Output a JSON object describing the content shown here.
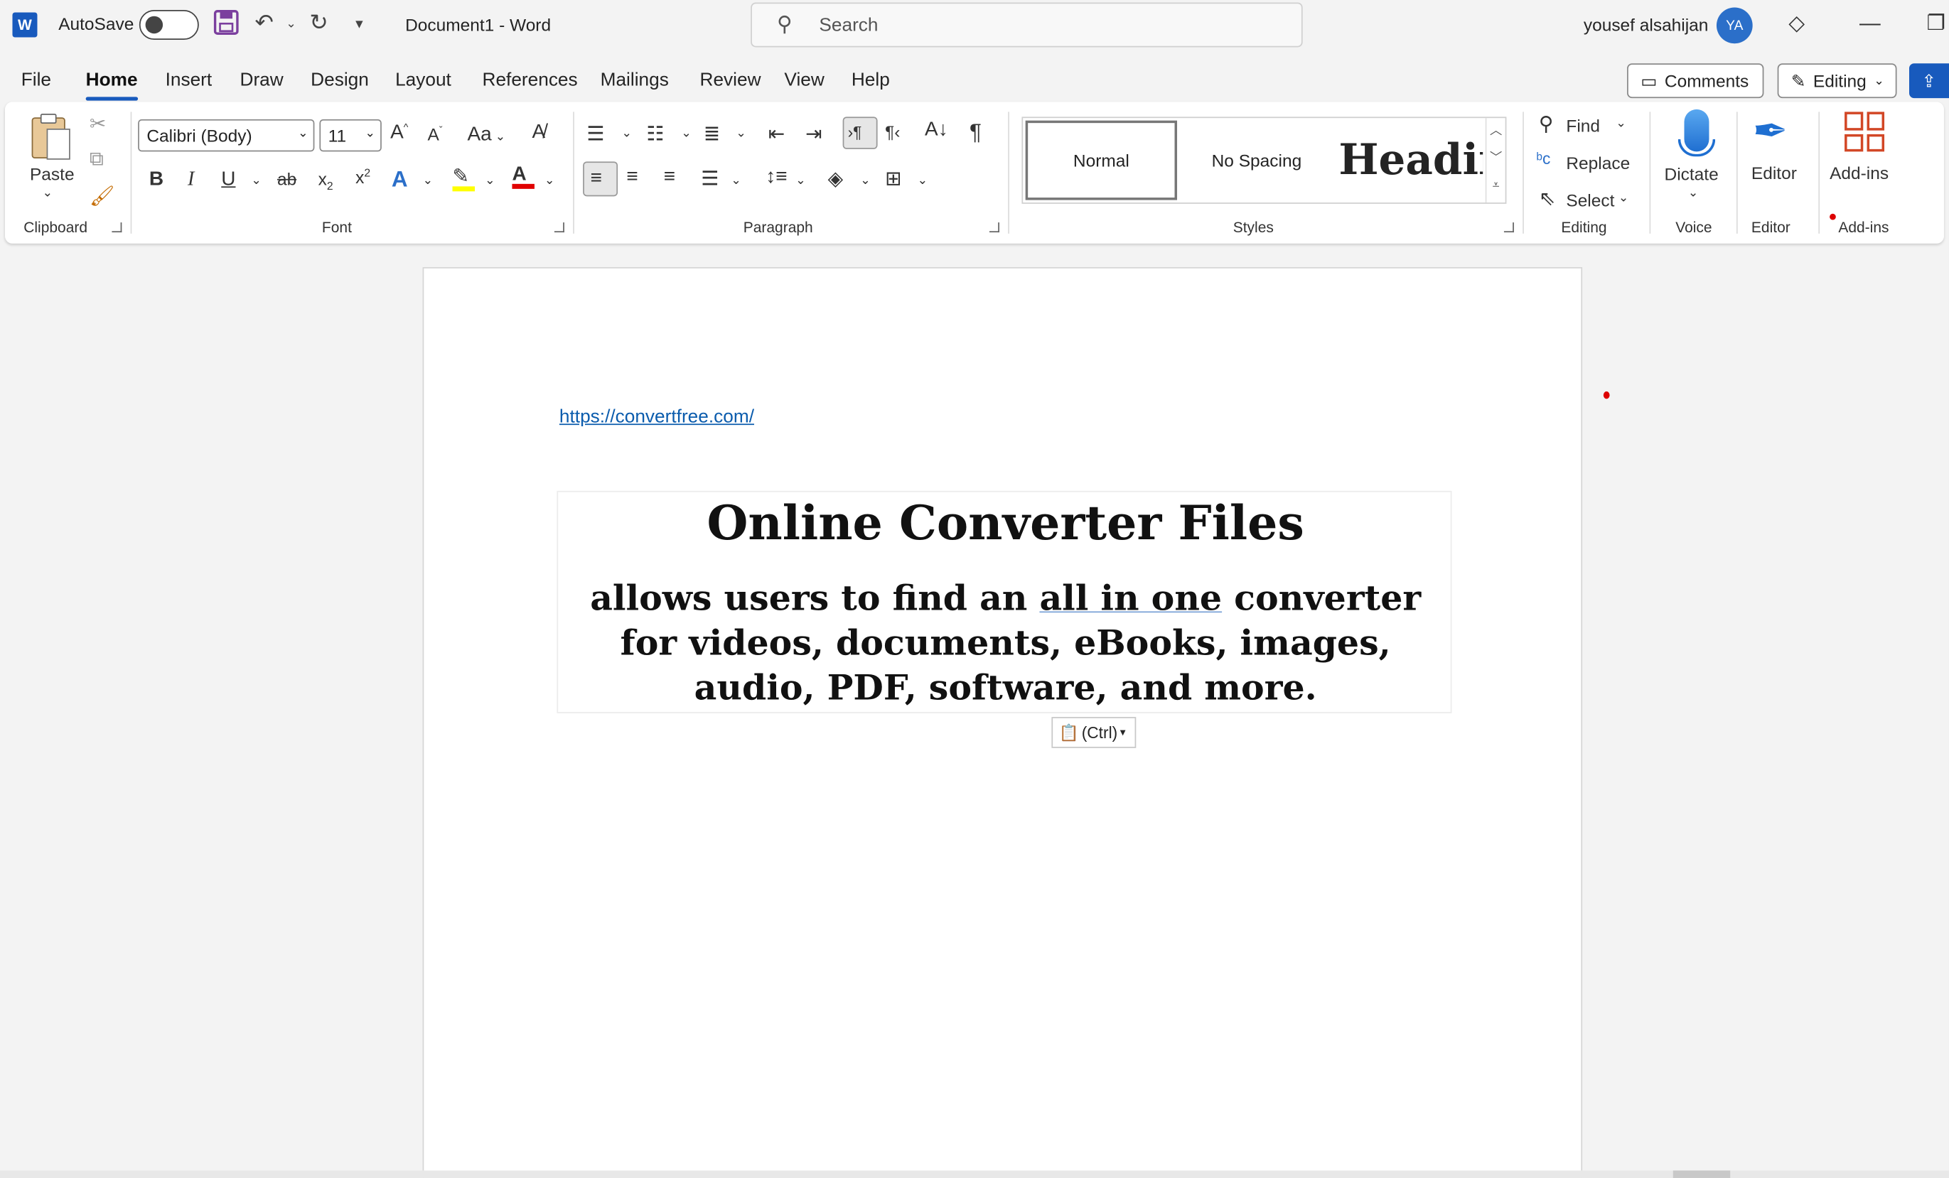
{
  "titlebar": {
    "app_logo": "W",
    "autosave_label": "AutoSave",
    "autosave_on": false,
    "doc_title": "Document1  -  Word",
    "search_placeholder": "Search",
    "user_name": "yousef alsahijan",
    "user_initials": "YA"
  },
  "menu": {
    "items": [
      "File",
      "Home",
      "Insert",
      "Draw",
      "Design",
      "Layout",
      "References",
      "Mailings",
      "Review",
      "View",
      "Help"
    ],
    "active": "Home",
    "comments_label": "Comments",
    "editing_label": "Editing"
  },
  "ribbon": {
    "clipboard": {
      "paste_label": "Paste",
      "group_label": "Clipboard"
    },
    "font": {
      "font_name": "Calibri (Body)",
      "font_size": "11",
      "change_case": "Aa",
      "group_label": "Font"
    },
    "paragraph": {
      "group_label": "Paragraph"
    },
    "styles": {
      "normal": "Normal",
      "no_spacing": "No Spacing",
      "heading": "Headin",
      "group_label": "Styles"
    },
    "editing": {
      "find": "Find",
      "replace": "Replace",
      "select": "Select",
      "group_label": "Editing"
    },
    "voice": {
      "dictate": "Dictate",
      "group_label": "Voice"
    },
    "editor": {
      "editor": "Editor",
      "group_label": "Editor"
    },
    "addins": {
      "addins": "Add-ins",
      "group_label": "Add-ins"
    },
    "colors": {
      "highlight": "#ffff00",
      "font_color": "#e00000"
    }
  },
  "document": {
    "link": "https://convertfree.com/",
    "heading": "Online Converter Files",
    "body_before": "allows users to find an ",
    "body_underlined": "all in one",
    "body_after": " converter for videos, documents, eBooks, images, audio, PDF, software, and more.",
    "paste_options": "(Ctrl)"
  }
}
